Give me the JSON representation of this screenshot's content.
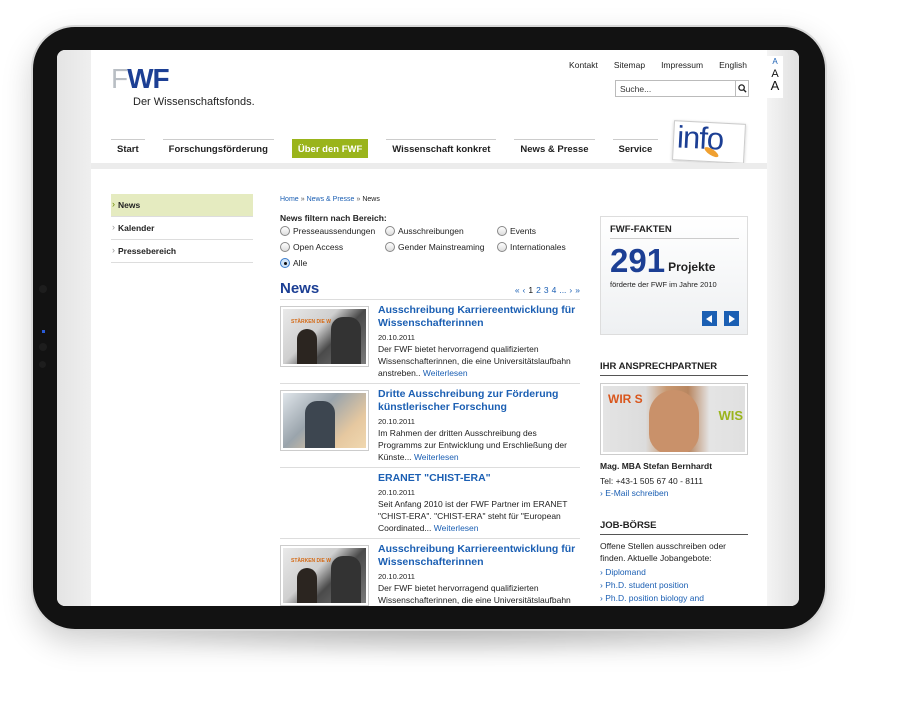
{
  "font_size_controls": [
    "A",
    "A",
    "A"
  ],
  "logo": {
    "mark_light": "F",
    "mark_dark": "WF",
    "subtitle": "Der Wissenschaftsfonds."
  },
  "top_links": [
    "Kontakt",
    "Sitemap",
    "Impressum",
    "English"
  ],
  "search": {
    "placeholder": "Suche...",
    "icon": "search-icon"
  },
  "info_badge": {
    "text": "info"
  },
  "nav": {
    "items": [
      "Start",
      "Forschungsförderung",
      "Über den FWF",
      "Wissenschaft konkret",
      "News & Presse",
      "Service"
    ],
    "active": "Über den FWF"
  },
  "subnav": {
    "items": [
      "News",
      "Kalender",
      "Pressebereich"
    ],
    "active": "News"
  },
  "breadcrumb": {
    "items": [
      "Home",
      "News & Presse"
    ],
    "separator": "»",
    "current": "News"
  },
  "filter": {
    "title": "News filtern nach Bereich:",
    "options": [
      "Presseaussendungen",
      "Ausschreibungen",
      "Events",
      "Open Access",
      "Gender Mainstreaming",
      "Internationales",
      "Alle"
    ],
    "selected": "Alle"
  },
  "news": {
    "title": "News",
    "pager": {
      "first": "«",
      "prev": "‹",
      "pages": [
        "1",
        "2",
        "3",
        "4"
      ],
      "ellipsis": "...",
      "next": "›",
      "last": "»",
      "current": "1"
    },
    "read_more": "Weiterlesen",
    "items": [
      {
        "title": "Ausschreibung Karriereentwicklung für Wissenschafterinnen",
        "date": "20.10.2011",
        "text": "Der FWF bietet hervorragend qualifizierten Wissenschafterinnen, die eine Universitätslaufbahn anstreben..",
        "has_image": true,
        "image_banner": "STÄRKEN DIE W"
      },
      {
        "title": "Dritte Ausschreibung zur Förderung künstlerischer Forschung",
        "date": "20.10.2011",
        "text": "Im Rahmen der dritten Ausschreibung des Programms zur Entwicklung und Erschließung der Künste...",
        "has_image": true
      },
      {
        "title": "ERANET \"CHIST-ERA\"",
        "date": "20.10.2011",
        "text": "Seit Anfang 2010 ist der FWF Partner im ERANET \"CHIST-ERA\". \"CHIST-ERA\" steht für \"European Coordinated...",
        "has_image": false
      },
      {
        "title": "Ausschreibung Karriereentwicklung für Wissenschafterinnen",
        "date": "20.10.2011",
        "text": "Der FWF bietet hervorragend qualifizierten Wissenschafterinnen, die eine Universitätslaufbahn",
        "has_image": true,
        "image_banner": "STÄRKEN DIE W"
      }
    ]
  },
  "facts": {
    "title": "FWF-FAKTEN",
    "number": "291",
    "unit": "Projekte",
    "description": "förderte der FWF im Jahre 2010",
    "prev_icon": "◀",
    "next_icon": "▶"
  },
  "contact": {
    "title": "IHR ANSPRECHPARTNER",
    "photo_text_left": "WIR S",
    "photo_text_right": "WIS",
    "name": "Mag. MBA Stefan Bernhardt",
    "tel": "Tel: +43-1 505 67 40 - 8111",
    "email_link": "› E-Mail schreiben"
  },
  "jobs": {
    "title": "JOB-BÖRSE",
    "text": "Offene Stellen ausschreiben oder finden. Aktuelle Jobangebote:",
    "links": [
      "› Diplomand",
      "› Ph.D. student position",
      "› Ph.D. position biology and"
    ]
  },
  "colors": {
    "brand_blue": "#1c3f94",
    "link_blue": "#1b5fb3",
    "accent_green": "#9ab41b"
  }
}
